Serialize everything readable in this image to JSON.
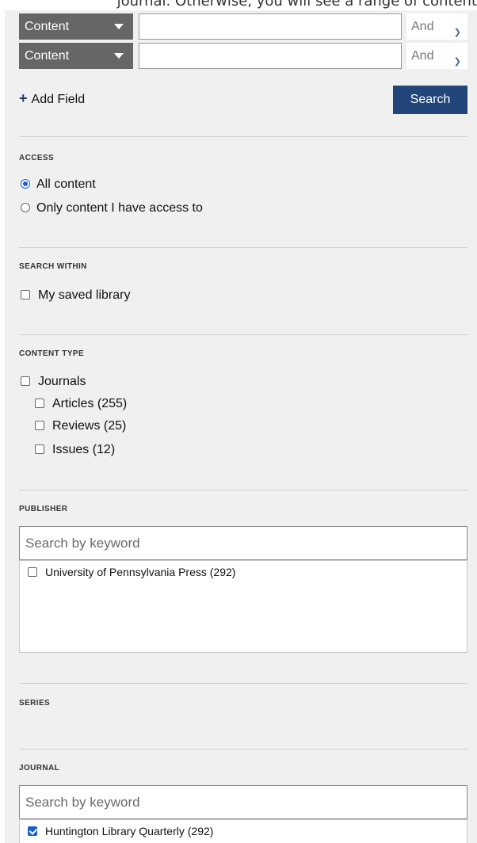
{
  "intro_text": "journal. Otherwise, you will see a range of content",
  "search_rows": [
    {
      "field": "Content",
      "term": "",
      "operator": "And"
    },
    {
      "field": "Content",
      "term": "",
      "operator": "And"
    }
  ],
  "add_field_label": "Add Field",
  "search_button_label": "Search",
  "access": {
    "title": "ACCESS",
    "options": [
      {
        "label": "All content",
        "selected": true
      },
      {
        "label": "Only content I have access to",
        "selected": false
      }
    ]
  },
  "search_within": {
    "title": "SEARCH WITHIN",
    "options": [
      {
        "label": "My saved library",
        "checked": false
      }
    ]
  },
  "content_type": {
    "title": "CONTENT TYPE",
    "parent": {
      "label": "Journals",
      "checked": false
    },
    "children": [
      {
        "label": "Articles (255)",
        "checked": false
      },
      {
        "label": "Reviews (25)",
        "checked": false
      },
      {
        "label": "Issues (12)",
        "checked": false
      }
    ]
  },
  "publisher": {
    "title": "PUBLISHER",
    "placeholder": "Search by keyword",
    "items": [
      {
        "label": "University of Pennsylvania Press (292)",
        "checked": false
      }
    ]
  },
  "series": {
    "title": "SERIES"
  },
  "journal": {
    "title": "JOURNAL",
    "placeholder": "Search by keyword",
    "items": [
      {
        "label": "Huntington Library Quarterly (292)",
        "checked": true
      }
    ]
  },
  "colors": {
    "primary": "#23467a",
    "field_select": "#666666",
    "panel": "#f0f0f0",
    "accent": "#1a5fd0"
  }
}
